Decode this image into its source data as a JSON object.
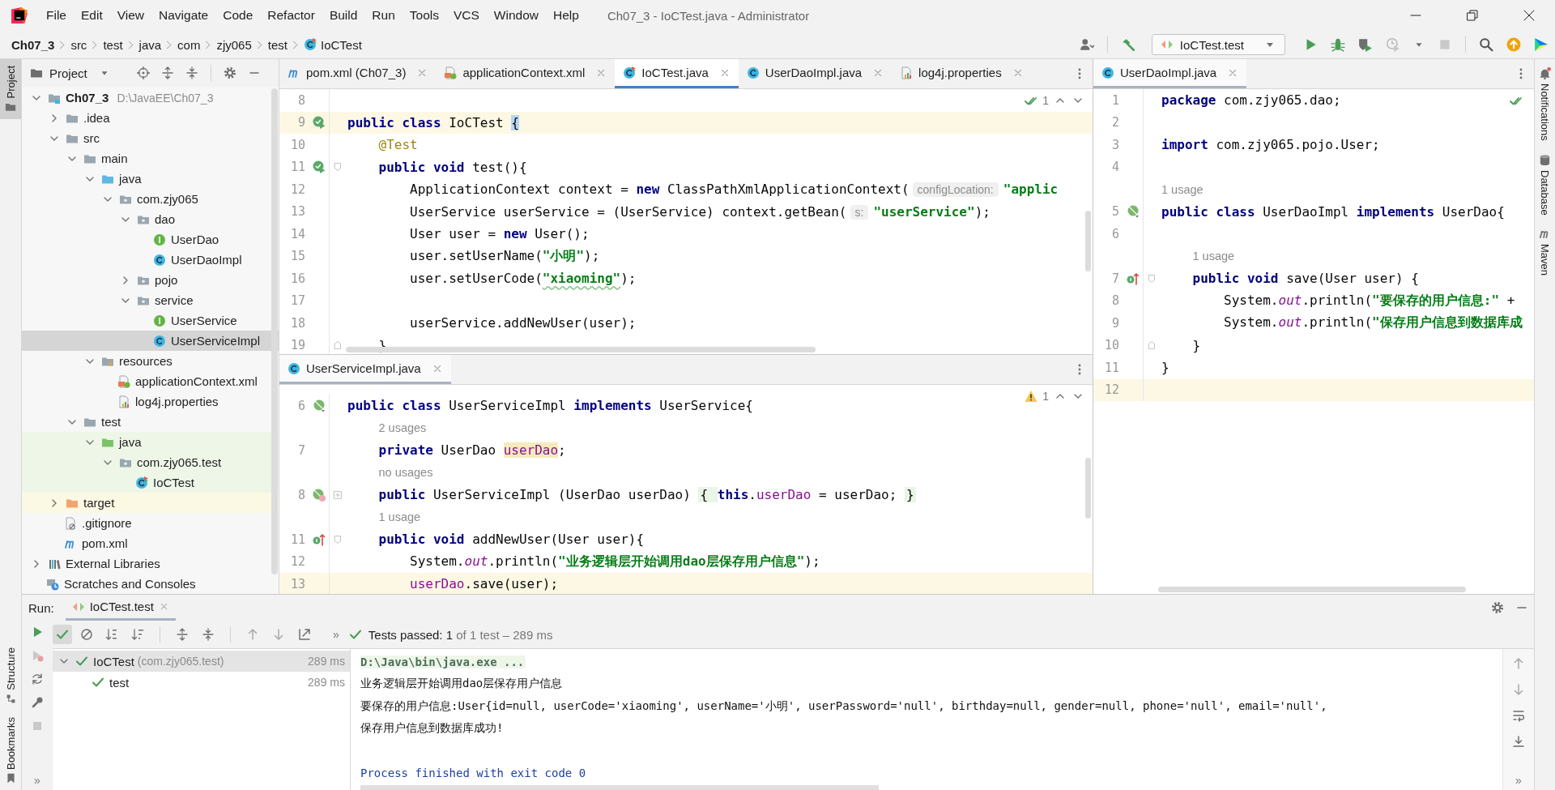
{
  "window": {
    "title": "Ch07_3 - IoCTest.java - Administrator"
  },
  "menu": [
    "File",
    "Edit",
    "View",
    "Navigate",
    "Code",
    "Refactor",
    "Build",
    "Run",
    "Tools",
    "VCS",
    "Window",
    "Help"
  ],
  "breadcrumbs": [
    {
      "label": "Ch07_3",
      "kind": "project"
    },
    {
      "label": "src",
      "kind": "folder"
    },
    {
      "label": "test",
      "kind": "folder"
    },
    {
      "label": "java",
      "kind": "folder"
    },
    {
      "label": "com",
      "kind": "folder"
    },
    {
      "label": "zjy065",
      "kind": "folder"
    },
    {
      "label": "test",
      "kind": "folder"
    },
    {
      "label": "IoCTest",
      "kind": "test_class"
    }
  ],
  "run_config": {
    "label": "IoCTest.test"
  },
  "left_strip": {
    "top": [
      {
        "label": "Project",
        "selected": true
      }
    ],
    "bottom": [
      {
        "label": "Structure",
        "kind": "structure"
      },
      {
        "label": "Bookmarks",
        "kind": "bookmark"
      }
    ]
  },
  "right_strip": [
    {
      "label": "Notifications",
      "kind": "notifications"
    },
    {
      "label": "Database",
      "kind": "database"
    },
    {
      "label": "Maven",
      "kind": "maven"
    }
  ],
  "project": {
    "title": "Project",
    "tree": [
      {
        "label": "Ch07_3",
        "path": "D:\\JavaEE\\Ch07_3",
        "kind": "module",
        "expanded": true,
        "selected": false,
        "children": [
          {
            "label": ".idea",
            "kind": "folder",
            "expanded": false,
            "selected": false
          },
          {
            "label": "src",
            "kind": "folder",
            "expanded": true,
            "selected": false,
            "children": [
              {
                "label": "main",
                "kind": "folder",
                "expanded": true,
                "selected": false,
                "children": [
                  {
                    "label": "java",
                    "kind": "source_root",
                    "expanded": true,
                    "selected": false,
                    "children": [
                      {
                        "label": "com.zjy065",
                        "kind": "package",
                        "expanded": true,
                        "selected": false,
                        "children": [
                          {
                            "label": "dao",
                            "kind": "package",
                            "expanded": true,
                            "selected": false,
                            "children": [
                              {
                                "label": "UserDao",
                                "kind": "interface",
                                "selected": false
                              },
                              {
                                "label": "UserDaoImpl",
                                "kind": "class",
                                "selected": false
                              }
                            ]
                          },
                          {
                            "label": "pojo",
                            "kind": "package",
                            "expanded": false,
                            "selected": false
                          },
                          {
                            "label": "service",
                            "kind": "package",
                            "expanded": true,
                            "selected": false,
                            "children": [
                              {
                                "label": "UserService",
                                "kind": "interface",
                                "selected": false
                              },
                              {
                                "label": "UserServiceImpl",
                                "kind": "class",
                                "selected": true
                              }
                            ]
                          }
                        ]
                      }
                    ]
                  },
                  {
                    "label": "resources",
                    "kind": "resources_root",
                    "expanded": true,
                    "selected": false,
                    "children": [
                      {
                        "label": "applicationContext.xml",
                        "kind": "xml",
                        "selected": false
                      },
                      {
                        "label": "log4j.properties",
                        "kind": "properties",
                        "selected": false
                      }
                    ]
                  }
                ]
              },
              {
                "label": "test",
                "kind": "folder",
                "expanded": true,
                "selected": false,
                "children": [
                  {
                    "label": "java",
                    "kind": "test_root",
                    "expanded": true,
                    "selected": false,
                    "test_source": true,
                    "children": [
                      {
                        "label": "com.zjy065.test",
                        "kind": "package",
                        "expanded": true,
                        "selected": false,
                        "test_source": true,
                        "children": [
                          {
                            "label": "IoCTest",
                            "kind": "test_class",
                            "selected": false,
                            "test_source": true
                          }
                        ]
                      }
                    ]
                  }
                ]
              }
            ]
          },
          {
            "label": "target",
            "kind": "excluded",
            "expanded": false,
            "selected": false,
            "excluded": true
          },
          {
            "label": ".gitignore",
            "kind": "gitignore",
            "selected": false
          },
          {
            "label": "pom.xml",
            "kind": "maven",
            "selected": false
          }
        ]
      },
      {
        "label": "External Libraries",
        "kind": "libraries",
        "expanded": false,
        "selected": false
      },
      {
        "label": "Scratches and Consoles",
        "kind": "scratches",
        "selected": false
      }
    ]
  },
  "editors": [
    {
      "active": true,
      "inspection": {
        "kind": "ok",
        "count": "1"
      },
      "tabs": [
        {
          "label": "pom.xml (Ch07_3)",
          "kind": "maven",
          "selected": false
        },
        {
          "label": "applicationContext.xml",
          "kind": "xml",
          "selected": false
        },
        {
          "label": "IoCTest.java",
          "kind": "test_class",
          "selected": true
        },
        {
          "label": "UserDaoImpl.java",
          "kind": "class",
          "selected": false
        },
        {
          "label": "log4j.properties",
          "kind": "properties",
          "selected": false
        }
      ],
      "lines": [
        {
          "n": "8"
        },
        {
          "n": "9",
          "current": true,
          "gutter": {
            "kind": "run"
          },
          "segs": [
            {
              "kind": "kw",
              "text": "public class "
            },
            {
              "kind": "plain",
              "text": "IoCTest "
            },
            {
              "kind": "brace",
              "text": "{"
            }
          ]
        },
        {
          "n": "10",
          "segs": [
            {
              "kind": "annot",
              "text": "    @Test"
            }
          ]
        },
        {
          "n": "11",
          "gutter": {
            "kind": "run"
          },
          "fold": {
            "kind": "start"
          },
          "segs": [
            {
              "kind": "kw",
              "text": "    public void "
            },
            {
              "kind": "plain",
              "text": "test(){"
            }
          ]
        },
        {
          "n": "12",
          "segs": [
            {
              "kind": "plain",
              "text": "        ApplicationContext context = "
            },
            {
              "kind": "kw",
              "text": "new "
            },
            {
              "kind": "plain",
              "text": "ClassPathXmlApplicationContext("
            },
            {
              "kind": "hint",
              "text": "configLocation:"
            },
            {
              "kind": "str",
              "text": "\"applic"
            }
          ]
        },
        {
          "n": "13",
          "segs": [
            {
              "kind": "plain",
              "text": "        UserService userService = (UserService) context.getBean("
            },
            {
              "kind": "hint",
              "text": "s:"
            },
            {
              "kind": "str",
              "text": "\"userService\""
            },
            {
              "kind": "plain",
              "text": ");"
            }
          ]
        },
        {
          "n": "14",
          "segs": [
            {
              "kind": "plain",
              "text": "        User user = "
            },
            {
              "kind": "kw",
              "text": "new "
            },
            {
              "kind": "plain",
              "text": "User();"
            }
          ]
        },
        {
          "n": "15",
          "segs": [
            {
              "kind": "plain",
              "text": "        user.setUserName("
            },
            {
              "kind": "str",
              "text": "\"小明\""
            },
            {
              "kind": "plain",
              "text": ");"
            }
          ]
        },
        {
          "n": "16",
          "segs": [
            {
              "kind": "plain",
              "text": "        user.setUserCode("
            },
            {
              "kind": "typo",
              "text": "\"xiaoming\""
            },
            {
              "kind": "plain",
              "text": ");"
            }
          ]
        },
        {
          "n": "17"
        },
        {
          "n": "18",
          "segs": [
            {
              "kind": "plain",
              "text": "        userService.addNewUser(user);"
            }
          ]
        },
        {
          "n": "19",
          "fold": {
            "kind": "end"
          },
          "segs": [
            {
              "kind": "plain",
              "text": "    }"
            }
          ]
        }
      ]
    },
    {
      "active": false,
      "inspection": {
        "kind": "warning",
        "count": "1"
      },
      "tabs": [
        {
          "label": "UserServiceImpl.java",
          "kind": "class",
          "selected": true
        }
      ],
      "lines": [
        {
          "n": "6",
          "gutter": {
            "kind": "impl"
          },
          "segs": [
            {
              "kind": "kw",
              "text": "public class "
            },
            {
              "kind": "plain",
              "text": "UserServiceImpl "
            },
            {
              "kind": "kw",
              "text": "implements "
            },
            {
              "kind": "plain",
              "text": "UserService{"
            }
          ]
        },
        {
          "usage": "2 usages"
        },
        {
          "n": "7",
          "segs": [
            {
              "kind": "kw",
              "text": "    private "
            },
            {
              "kind": "plain",
              "text": "UserDao "
            },
            {
              "kind": "mark",
              "text": "userDao"
            },
            {
              "kind": "plain",
              "text": ";"
            }
          ]
        },
        {
          "usage": "no usages"
        },
        {
          "n": "8",
          "gutter": {
            "kind": "impl_m"
          },
          "fold": {
            "kind": "collapsed"
          },
          "segs": [
            {
              "kind": "kw",
              "text": "    public "
            },
            {
              "kind": "plain",
              "text": "UserServiceImpl (UserDao userDao) "
            },
            {
              "kind": "fold",
              "text": "{ "
            },
            {
              "kind": "kw",
              "text": "this"
            },
            {
              "kind": "plain",
              "text": "."
            },
            {
              "kind": "field",
              "text": "userDao"
            },
            {
              "kind": "plain",
              "text": " = userDao; "
            },
            {
              "kind": "fold",
              "text": "}"
            }
          ]
        },
        {
          "usage": "1 usage"
        },
        {
          "n": "11",
          "gutter": {
            "kind": "override"
          },
          "fold": {
            "kind": "start"
          },
          "segs": [
            {
              "kind": "kw",
              "text": "    public void "
            },
            {
              "kind": "plain",
              "text": "addNewUser(User user){"
            }
          ]
        },
        {
          "n": "12",
          "segs": [
            {
              "kind": "plain",
              "text": "        System."
            },
            {
              "kind": "static",
              "text": "out"
            },
            {
              "kind": "plain",
              "text": ".println("
            },
            {
              "kind": "str",
              "text": "\"业务逻辑层开始调用dao层保存用户信息\""
            },
            {
              "kind": "plain",
              "text": ");"
            }
          ]
        },
        {
          "n": "13",
          "current": true,
          "segs": [
            {
              "kind": "field",
              "text": "        userDao"
            },
            {
              "kind": "plain",
              "text": ".save(user);"
            }
          ]
        }
      ]
    },
    {
      "active": false,
      "inspection": {
        "kind": "ok"
      },
      "tabs": [
        {
          "label": "UserDaoImpl.java",
          "kind": "class",
          "selected": true
        }
      ],
      "lines": [
        {
          "n": "1",
          "segs": [
            {
              "kind": "kw",
              "text": "package "
            },
            {
              "kind": "plain",
              "text": "com.zjy065.dao;"
            }
          ]
        },
        {
          "n": "2"
        },
        {
          "n": "3",
          "segs": [
            {
              "kind": "kw",
              "text": "import "
            },
            {
              "kind": "plain",
              "text": "com.zjy065.pojo.User;"
            }
          ]
        },
        {
          "n": "4"
        },
        {
          "usage": "1 usage"
        },
        {
          "n": "5",
          "gutter": {
            "kind": "impl"
          },
          "segs": [
            {
              "kind": "kw",
              "text": "public class "
            },
            {
              "kind": "plain",
              "text": "UserDaoImpl "
            },
            {
              "kind": "kw",
              "text": "implements "
            },
            {
              "kind": "plain",
              "text": "UserDao{"
            }
          ]
        },
        {
          "n": "6"
        },
        {
          "usage": "1 usage"
        },
        {
          "n": "7",
          "gutter": {
            "kind": "override"
          },
          "fold": {
            "kind": "start"
          },
          "segs": [
            {
              "kind": "kw",
              "text": "    public void "
            },
            {
              "kind": "plain",
              "text": "save(User user) {"
            }
          ]
        },
        {
          "n": "8",
          "segs": [
            {
              "kind": "plain",
              "text": "        System."
            },
            {
              "kind": "static",
              "text": "out"
            },
            {
              "kind": "plain",
              "text": ".println("
            },
            {
              "kind": "str",
              "text": "\"要保存的用户信息:\""
            },
            {
              "kind": "plain",
              "text": " +"
            }
          ]
        },
        {
          "n": "9",
          "segs": [
            {
              "kind": "plain",
              "text": "        System."
            },
            {
              "kind": "static",
              "text": "out"
            },
            {
              "kind": "plain",
              "text": ".println("
            },
            {
              "kind": "str",
              "text": "\"保存用户信息到数据库成"
            }
          ]
        },
        {
          "n": "10",
          "fold": {
            "kind": "end"
          },
          "segs": [
            {
              "kind": "plain",
              "text": "    }"
            }
          ]
        },
        {
          "n": "11",
          "segs": [
            {
              "kind": "plain",
              "text": "}"
            }
          ]
        },
        {
          "n": "12",
          "current": true
        }
      ]
    }
  ],
  "run_panel": {
    "label": "Run:",
    "tabs": [
      {
        "label": "IoCTest.test",
        "selected": true
      }
    ],
    "toolbar": [
      {
        "kind": "show_passed",
        "pressed": true
      },
      {
        "kind": "show_ignored",
        "pressed": false
      }
    ],
    "overflow": "»",
    "left_more": "»",
    "right_more": "»",
    "status": {
      "title": "Tests passed:",
      "count": "1",
      "detail": "of 1 test – 289 ms"
    },
    "tests": [
      {
        "label": "IoCTest",
        "detail": "(com.zjy065.test)",
        "time": "289 ms",
        "passed": true,
        "expanded": true,
        "selected": true,
        "children": [
          {
            "label": "test",
            "time": "289 ms",
            "passed": true,
            "selected": false
          }
        ]
      }
    ],
    "console": [
      {
        "kind": "command",
        "text": "D:\\Java\\bin\\java.exe ..."
      },
      {
        "kind": "out",
        "text": "业务逻辑层开始调用dao层保存用户信息"
      },
      {
        "kind": "out",
        "text": "要保存的用户信息:User{id=null, userCode='xiaoming', userName='小明', userPassword='null', birthday=null, gender=null, phone='null', email='null',"
      },
      {
        "kind": "out",
        "text": "保存用户信息到数据库成功!"
      },
      {
        "kind": "blank"
      },
      {
        "kind": "exit",
        "text": "Process finished with exit code 0"
      }
    ]
  }
}
